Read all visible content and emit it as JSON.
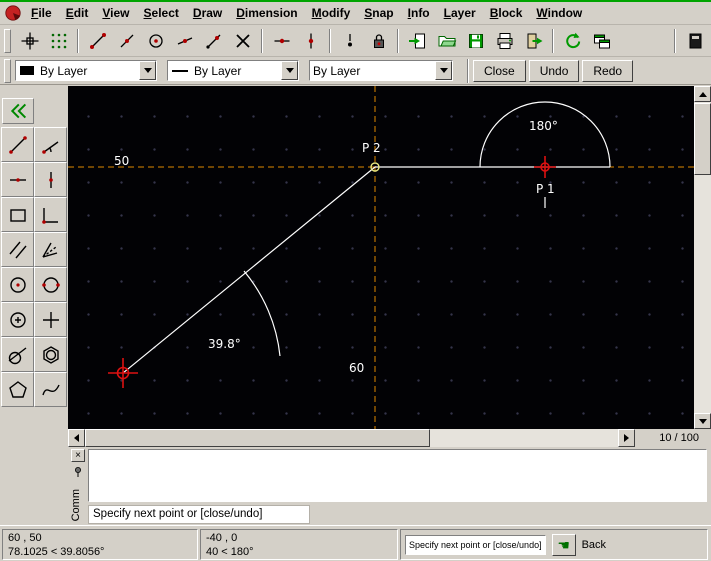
{
  "menu": {
    "items": [
      "File",
      "Edit",
      "View",
      "Select",
      "Draw",
      "Dimension",
      "Modify",
      "Snap",
      "Info",
      "Layer",
      "Block",
      "Window"
    ]
  },
  "toolbar": {
    "icons": [
      "crosshair",
      "grid-points",
      "snap-endpoint",
      "snap-middle",
      "snap-center",
      "snap-on-entity",
      "snap-distance",
      "snap-intersection",
      "restrict-horizontal",
      "restrict-vertical",
      "snap-coordinate",
      "lock-relative-zero",
      "new-drawing",
      "open-drawing",
      "save-drawing",
      "print-drawing",
      "close-drawing",
      "redraw",
      "windows",
      "dock"
    ]
  },
  "attributes": {
    "color_label": "By Layer",
    "width_label": "By Layer",
    "linetype_label": "By Layer",
    "close_button": "Close",
    "undo_button": "Undo",
    "redo_button": "Redo"
  },
  "palette": {
    "icons": [
      "back",
      "line-2-points",
      "line-angle",
      "line-horizontal",
      "line-vertical",
      "rectangle",
      "line-orthogonal",
      "line-parallel",
      "line-bisector",
      "circle-center-point",
      "circle-2-points",
      "circle-center-radius",
      "point",
      "line-tangent",
      "polygon-inscribed",
      "polygon",
      "spline"
    ]
  },
  "canvas": {
    "labels": {
      "p2": "P 2",
      "p1": "P 1",
      "horizontal_dim": "50",
      "vertical_dim": "60",
      "arc_angle": "180°",
      "line_angle": "39.8°"
    }
  },
  "scrollbars": {
    "page_indicator": "10 / 100"
  },
  "command": {
    "tab_label": "Comm",
    "close_glyph": "×",
    "prompt": "Specify next point or [close/undo]"
  },
  "status": {
    "absolute_coord": "60 , 50",
    "absolute_polar": "78.1025 < 39.8056°",
    "relative_coord": "-40 , 0",
    "relative_polar": "40 < 180°",
    "hint": "Specify next point or [close/undo]",
    "hand_glyph": "☚",
    "back_label": "Back"
  }
}
